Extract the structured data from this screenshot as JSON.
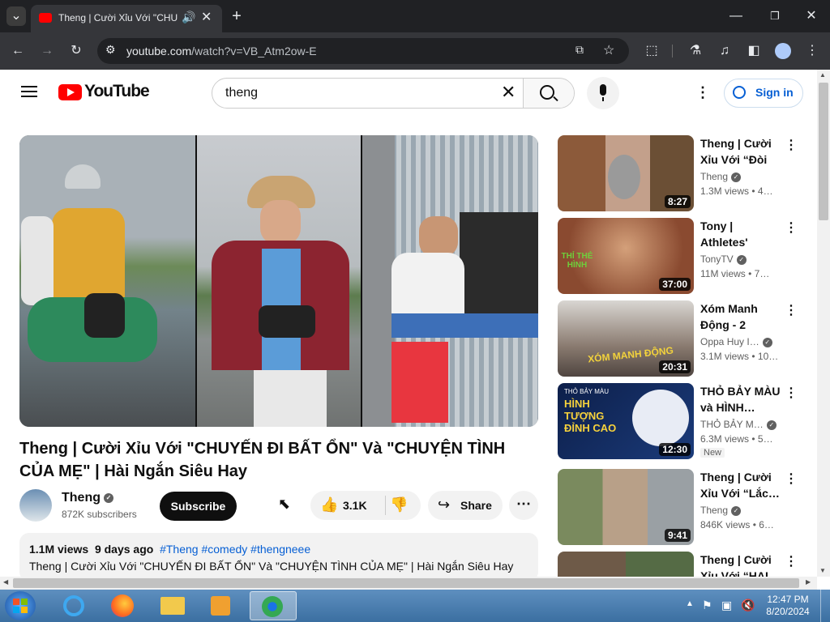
{
  "browser": {
    "tab_title": "Theng | Cười Xỉu Với \"CHU",
    "url_domain": "youtube.com",
    "url_path": "/watch?v=VB_Atm2ow-E"
  },
  "yt": {
    "logo_text": "YouTube",
    "search_query": "theng",
    "sign_in": "Sign in"
  },
  "video": {
    "title": "Theng | Cười Xỉu Với \"CHUYẾN ĐI BẤT ỔN\" Và \"CHUYỆN TÌNH CỦA MẸ\" | Hài Ngắn Siêu Hay",
    "channel": "Theng",
    "subscribers": "872K subscribers",
    "subscribe_label": "Subscribe",
    "likes": "3.1K",
    "share_label": "Share",
    "views": "1.1M views",
    "age": "9 days ago",
    "tags": "#Theng #comedy #thengneee",
    "description": "Theng | Cười Xỉu Với \"CHUYẾN ĐI BẤT ỔN\" Và \"CHUYỆN TÌNH CỦA MẸ\" | Hài Ngắn Siêu Hay"
  },
  "recommendations": [
    {
      "title": "Theng | Cười Xỉu Với “Đòi Đ…",
      "channel": "Theng",
      "views": "1.3M views",
      "age": "4…",
      "duration": "8:27"
    },
    {
      "title": "Tony | Athletes' Muscle…",
      "channel": "TonyTV",
      "views": "11M views",
      "age": "7…",
      "duration": "37:00"
    },
    {
      "title": "Xóm Manh Động - 2",
      "channel": "Oppa Huy I…",
      "views": "3.1M views",
      "age": "10…",
      "duration": "20:31"
    },
    {
      "title": "THỎ BẢY MÀU và HÌNH…",
      "channel": "THỎ BẢY M…",
      "views": "6.3M views",
      "age": "5…",
      "duration": "12:30",
      "badge": "New"
    },
    {
      "title": "Theng | Cười Xỉu Với “Lắc…",
      "channel": "Theng",
      "views": "846K views",
      "age": "6…",
      "duration": "9:41"
    },
    {
      "title": "Theng | Cười Xỉu Với “HAI…",
      "channel": "",
      "views": "",
      "age": "",
      "duration": ""
    }
  ],
  "thumb_text": {
    "rec2_left": "THỈ THẺ HÌNH",
    "rec3": "XÓM MANH ĐỘNG",
    "rec4_top": "THỎ BẢY MÀU",
    "rec4_main": "HÌNH TƯỢNG ĐỈNH CAO"
  },
  "taskbar": {
    "time": "12:47 PM",
    "date": "8/20/2024"
  },
  "colors": {
    "youtube_red": "#ff0000",
    "link_blue": "#065fd4",
    "chrome_dark": "#202124",
    "chrome_toolbar": "#35363a"
  }
}
